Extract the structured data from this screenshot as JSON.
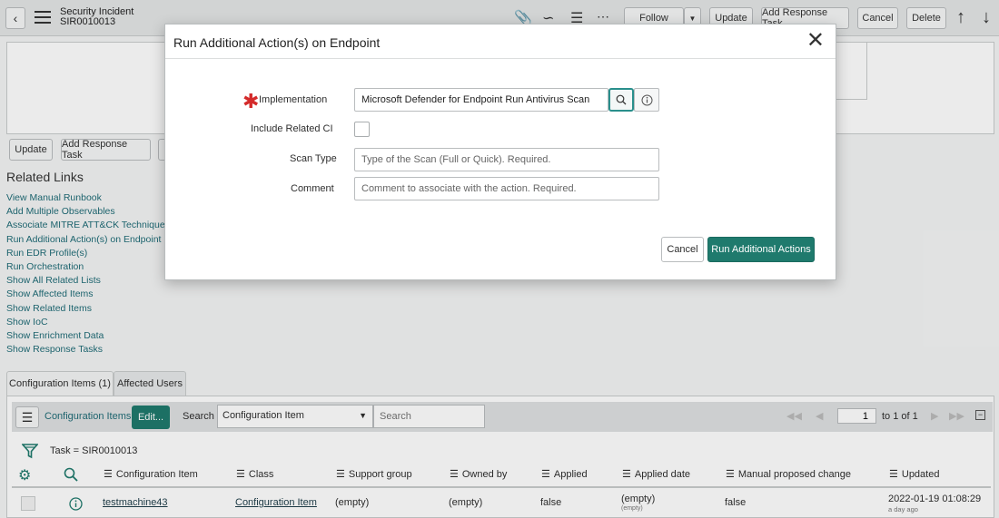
{
  "header": {
    "title": "Security Incident",
    "number": "SIR0010013",
    "follow_label": "Follow",
    "update_label": "Update",
    "add_response_task_label": "Add Response Task",
    "cancel_label": "Cancel",
    "delete_label": "Delete"
  },
  "form_buttons": {
    "update_label": "Update",
    "add_response_task_label": "Add Response Task"
  },
  "related_links": {
    "title": "Related Links",
    "items": [
      "View Manual Runbook",
      "Add Multiple Observables",
      "Associate MITRE ATT&CK Technique",
      "Run Additional Action(s) on Endpoint",
      "Run EDR Profile(s)",
      "Run Orchestration",
      "Show All Related Lists",
      "Show Affected Items",
      "Show Related Items",
      "Show IoC",
      "Show Enrichment Data",
      "Show Response Tasks"
    ]
  },
  "related_list": {
    "tabs": [
      "Configuration Items (1)",
      "Affected Users"
    ],
    "list_title": "Configuration Items",
    "edit_label": "Edit...",
    "search_label": "Search",
    "search_field": "Configuration Item",
    "search_placeholder": "Search",
    "page_value": "1",
    "page_total": "to 1 of 1",
    "filter": "Task = SIR0010013",
    "columns": [
      "Configuration Item",
      "Class",
      "Support group",
      "Owned by",
      "Applied",
      "Applied date",
      "Manual proposed change",
      "Updated"
    ],
    "row": {
      "configuration_item": "testmachine43",
      "class": "Configuration Item",
      "support_group": "(empty)",
      "owned_by": "(empty)",
      "applied": "false",
      "applied_date": "(empty)",
      "applied_date_sub": "(empty)",
      "manual_proposed_change": "false",
      "updated": "2022-01-19 01:08:29",
      "updated_sub": "a day ago"
    }
  },
  "modal": {
    "title": "Run Additional Action(s) on Endpoint",
    "implementation_label": "Implementation",
    "implementation_value": "Microsoft Defender for Endpoint Run Antivirus Scan",
    "include_related_ci_label": "Include Related CI",
    "scan_type_label": "Scan Type",
    "scan_type_placeholder": "Type of the Scan (Full or Quick). Required.",
    "comment_label": "Comment",
    "comment_placeholder": "Comment to associate with the action. Required.",
    "cancel_label": "Cancel",
    "run_label": "Run Additional Actions"
  },
  "colors": {
    "accent": "#1f7a6d",
    "link": "#1f6c77",
    "required": "#d42b2b"
  }
}
